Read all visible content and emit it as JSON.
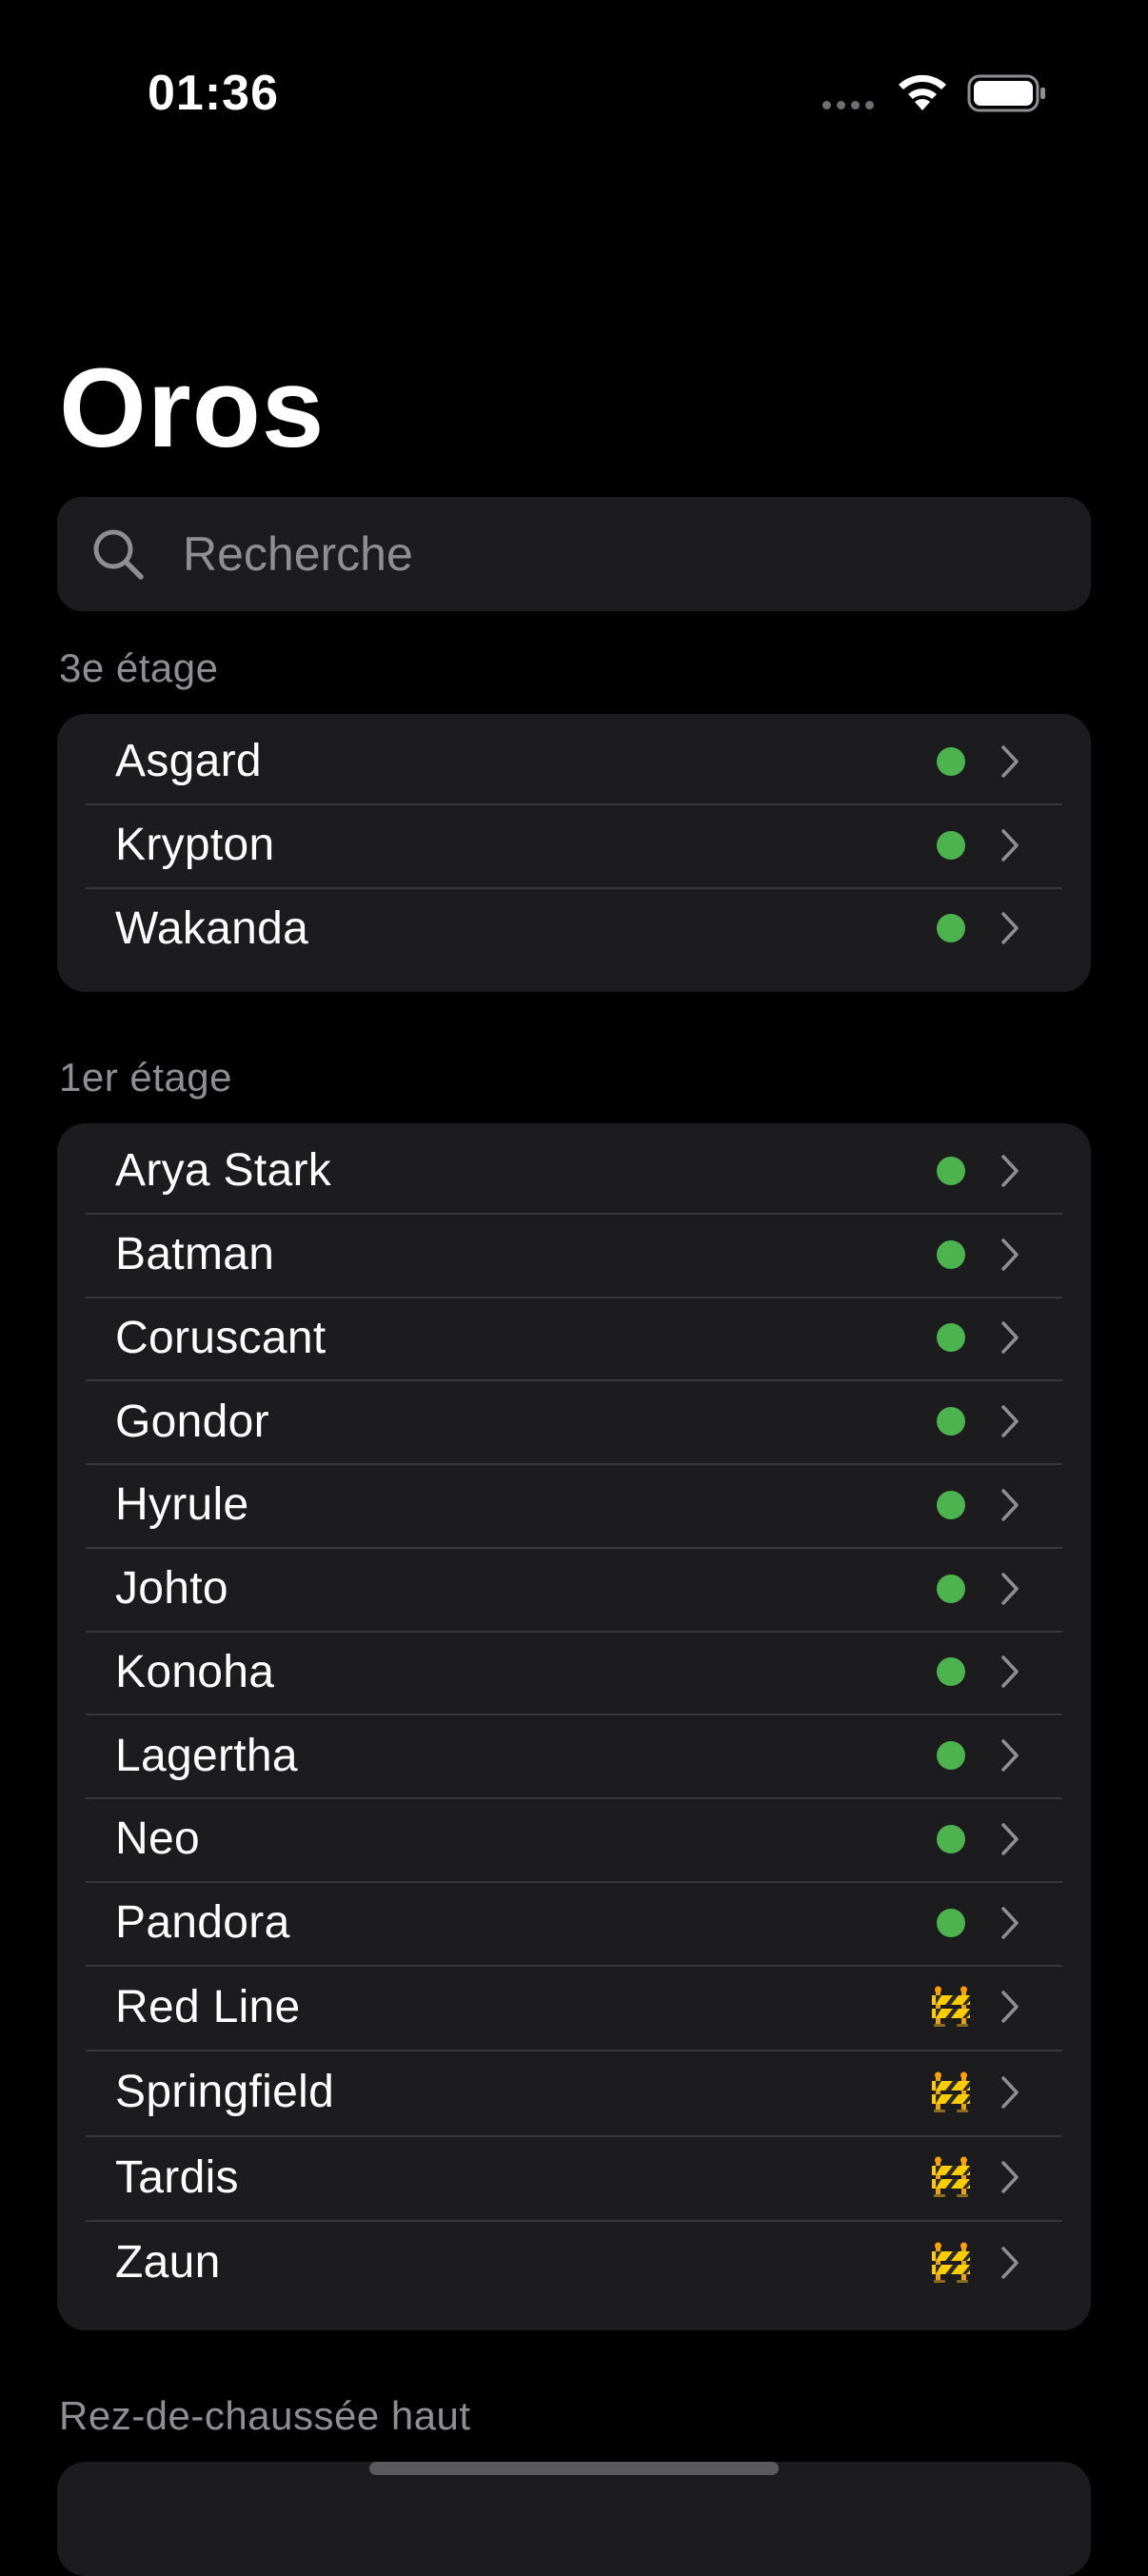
{
  "status_bar": {
    "time": "01:36"
  },
  "title": "Oros",
  "search": {
    "placeholder": "Recherche",
    "value": ""
  },
  "colors": {
    "available": "#4cb34f",
    "background": "#000000",
    "group_background": "#1c1c1e"
  },
  "sections": [
    {
      "header": "3e étage",
      "rows": [
        {
          "label": "Asgard",
          "status": "available"
        },
        {
          "label": "Krypton",
          "status": "available"
        },
        {
          "label": "Wakanda",
          "status": "available"
        }
      ]
    },
    {
      "header": "1er étage",
      "rows": [
        {
          "label": "Arya Stark",
          "status": "available"
        },
        {
          "label": "Batman",
          "status": "available"
        },
        {
          "label": "Coruscant",
          "status": "available"
        },
        {
          "label": "Gondor",
          "status": "available"
        },
        {
          "label": "Hyrule",
          "status": "available"
        },
        {
          "label": "Johto",
          "status": "available"
        },
        {
          "label": "Konoha",
          "status": "available"
        },
        {
          "label": "Lagertha",
          "status": "available"
        },
        {
          "label": "Neo",
          "status": "available"
        },
        {
          "label": "Pandora",
          "status": "available"
        },
        {
          "label": "Red Line",
          "status": "construction"
        },
        {
          "label": "Springfield",
          "status": "construction"
        },
        {
          "label": "Tardis",
          "status": "construction"
        },
        {
          "label": "Zaun",
          "status": "construction"
        }
      ]
    },
    {
      "header": "Rez-de-chaussée haut",
      "rows": []
    }
  ],
  "icons": {
    "search": "magnifying-glass",
    "row_chevron": "chevron-right",
    "available_status": "green-dot",
    "construction_status": "construction-barrier"
  }
}
